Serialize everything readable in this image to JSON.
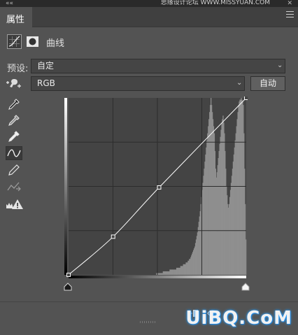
{
  "window": {
    "title_text": "思缘设计论坛 WWW.MISSYUAN.COM",
    "collapse_icon": "double-chevron-icon",
    "close_icon": "close-icon"
  },
  "panel": {
    "tab_label": "属性",
    "menu_icon": "panel-menu-icon"
  },
  "adjustment": {
    "title": "曲线",
    "curves_icon": "curves-adjustment-icon",
    "mask_icon": "layer-mask-icon"
  },
  "preset": {
    "label": "预设:",
    "value": "自定"
  },
  "channel": {
    "value": "RGB",
    "auto_label": "自动",
    "target_tool_icon": "on-image-adjust-icon"
  },
  "tools": [
    "black-point-eyedropper-icon",
    "gray-point-eyedropper-icon",
    "white-point-eyedropper-icon",
    "curve-points-tool-icon",
    "pencil-draw-icon",
    "smooth-curve-icon",
    "clipping-warning-icon"
  ],
  "curve": {
    "input_range": [
      0,
      255
    ],
    "output_range": [
      0,
      255
    ],
    "points": [
      [
        0,
        0
      ],
      [
        64,
        55
      ],
      [
        130,
        126
      ],
      [
        255,
        255
      ]
    ]
  },
  "histogram_samples": [
    0,
    0,
    0,
    0,
    0,
    0,
    0,
    0,
    0,
    0,
    0,
    0,
    0,
    0,
    0,
    0,
    0,
    0,
    0,
    0,
    0,
    0,
    0,
    0,
    0,
    0,
    0,
    0,
    0,
    0,
    0,
    0,
    0,
    0,
    0,
    0,
    0,
    0,
    0,
    0,
    0,
    0,
    0,
    0,
    0,
    0,
    0,
    0,
    0,
    0,
    0,
    0,
    0,
    0,
    0,
    0,
    0,
    0,
    0,
    0,
    0,
    0,
    0,
    0,
    0,
    0,
    0,
    0,
    0,
    0,
    0,
    0,
    0,
    0,
    0,
    0,
    0,
    0,
    0,
    0,
    0,
    0,
    0,
    0,
    0,
    0,
    0,
    0,
    0,
    0,
    0,
    0,
    0,
    0,
    0,
    0,
    0,
    0,
    0,
    0,
    0,
    0,
    0,
    0,
    0,
    0,
    0,
    0,
    0,
    0,
    0,
    0,
    0,
    0,
    0,
    0,
    0,
    0,
    0,
    0,
    0,
    0,
    0,
    0,
    0,
    0,
    0,
    0,
    0,
    0,
    1,
    1,
    1,
    1,
    1,
    1,
    1,
    1,
    1,
    1,
    2,
    2,
    2,
    2,
    2,
    2,
    2,
    2,
    2,
    2,
    3,
    3,
    3,
    3,
    3,
    3,
    3,
    3,
    3,
    3,
    4,
    4,
    4,
    4,
    4,
    4,
    5,
    5,
    5,
    5,
    6,
    6,
    6,
    6,
    7,
    7,
    7,
    8,
    8,
    9,
    9,
    10,
    11,
    12,
    13,
    14,
    15,
    16,
    18,
    20,
    22,
    24,
    27,
    30,
    33,
    36,
    40,
    44,
    48,
    52,
    56,
    60,
    64,
    68,
    72,
    76,
    80,
    84,
    88,
    92,
    96,
    100,
    96,
    92,
    88,
    84,
    80,
    70,
    60,
    55,
    58,
    62,
    66,
    70,
    74,
    78,
    82,
    86,
    88,
    90,
    86,
    80,
    70,
    60,
    50,
    45,
    40,
    38,
    40,
    44,
    48,
    52,
    56,
    60,
    64,
    68,
    72,
    76,
    80,
    84,
    88,
    92,
    96,
    98,
    99,
    99,
    100,
    99,
    98,
    96,
    80,
    60,
    40,
    20
  ],
  "footer": {
    "watermark": "UiBQ.CoM"
  }
}
